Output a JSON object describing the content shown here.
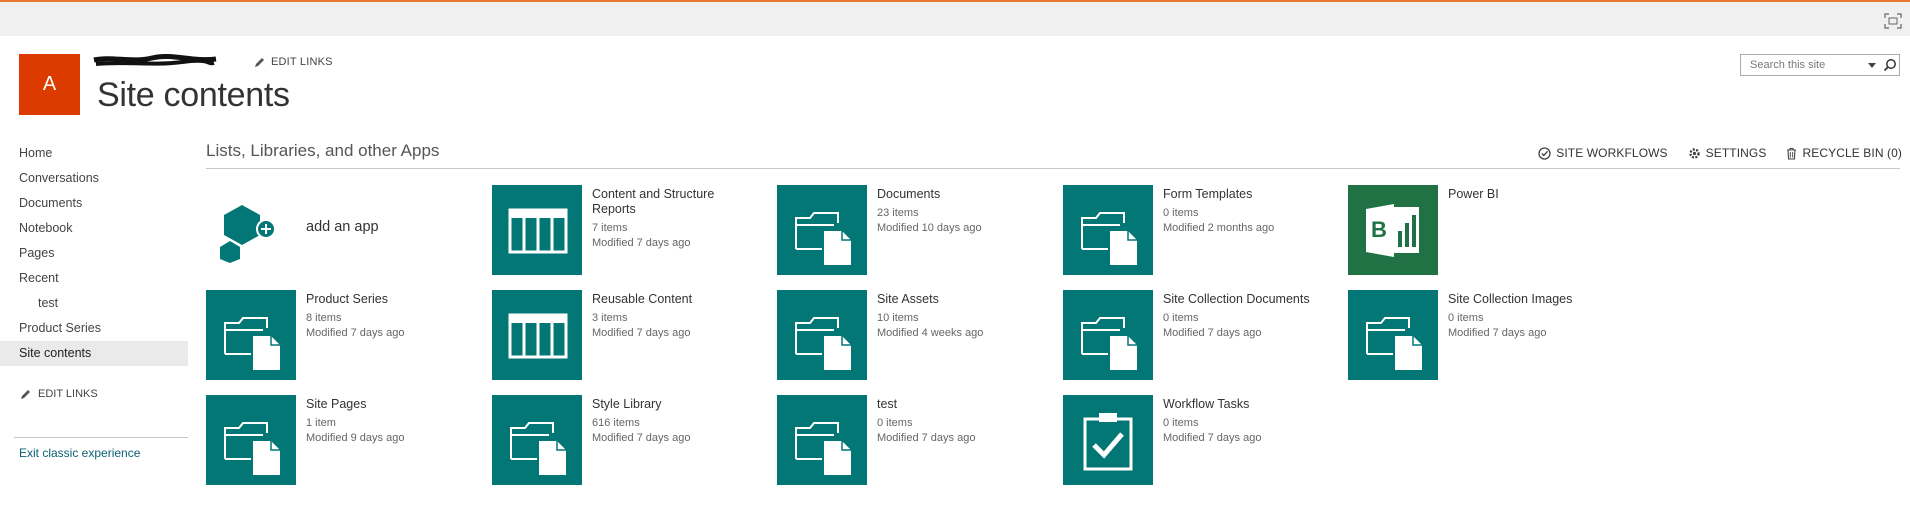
{
  "site": {
    "logo_letter": "A",
    "title": "Site contents",
    "edit_links": "EDIT LINKS"
  },
  "search": {
    "placeholder": "Search this site"
  },
  "leftnav": {
    "items": [
      {
        "label": "Home"
      },
      {
        "label": "Conversations"
      },
      {
        "label": "Documents"
      },
      {
        "label": "Notebook"
      },
      {
        "label": "Pages"
      },
      {
        "label": "Recent"
      },
      {
        "label": "test"
      },
      {
        "label": "Product Series"
      },
      {
        "label": "Site contents"
      }
    ],
    "edit_links": "EDIT LINKS",
    "exit_link": "Exit classic experience"
  },
  "section": {
    "title": "Lists, Libraries, and other Apps",
    "actions": {
      "workflows": "SITE WORKFLOWS",
      "settings": "SETTINGS",
      "recycle": "RECYCLE BIN (0)"
    }
  },
  "tiles": [
    {
      "name": "add an app",
      "icon": "add-app-icon"
    },
    {
      "name": "Content and Structure Reports",
      "count": "7 items",
      "modified": "Modified 7 days ago",
      "icon": "list-icon"
    },
    {
      "name": "Documents",
      "count": "23 items",
      "modified": "Modified 10 days ago",
      "icon": "folder-icon"
    },
    {
      "name": "Form Templates",
      "count": "0 items",
      "modified": "Modified 2 months ago",
      "icon": "folder-icon"
    },
    {
      "name": "Power BI",
      "icon": "power-bi-icon"
    },
    {
      "name": "Product Series",
      "count": "8 items",
      "modified": "Modified 7 days ago",
      "icon": "folder-icon"
    },
    {
      "name": "Reusable Content",
      "count": "3 items",
      "modified": "Modified 7 days ago",
      "icon": "list-icon"
    },
    {
      "name": "Site Assets",
      "count": "10 items",
      "modified": "Modified 4 weeks ago",
      "icon": "folder-icon"
    },
    {
      "name": "Site Collection Documents",
      "count": "0 items",
      "modified": "Modified 7 days ago",
      "icon": "folder-icon"
    },
    {
      "name": "Site Collection Images",
      "count": "0 items",
      "modified": "Modified 7 days ago",
      "icon": "folder-icon"
    },
    {
      "name": "Site Pages",
      "count": "1 item",
      "modified": "Modified 9 days ago",
      "icon": "folder-icon"
    },
    {
      "name": "Style Library",
      "count": "616 items",
      "modified": "Modified 7 days ago",
      "icon": "folder-icon"
    },
    {
      "name": "test",
      "count": "0 items",
      "modified": "Modified 7 days ago",
      "icon": "folder-icon"
    },
    {
      "name": "Workflow Tasks",
      "count": "0 items",
      "modified": "Modified 7 days ago",
      "icon": "tasks-icon"
    }
  ],
  "colors": {
    "tile": "#037776",
    "power_bi": "#207245",
    "logo": "#dc3b00",
    "top_accent": "#e8772e"
  }
}
